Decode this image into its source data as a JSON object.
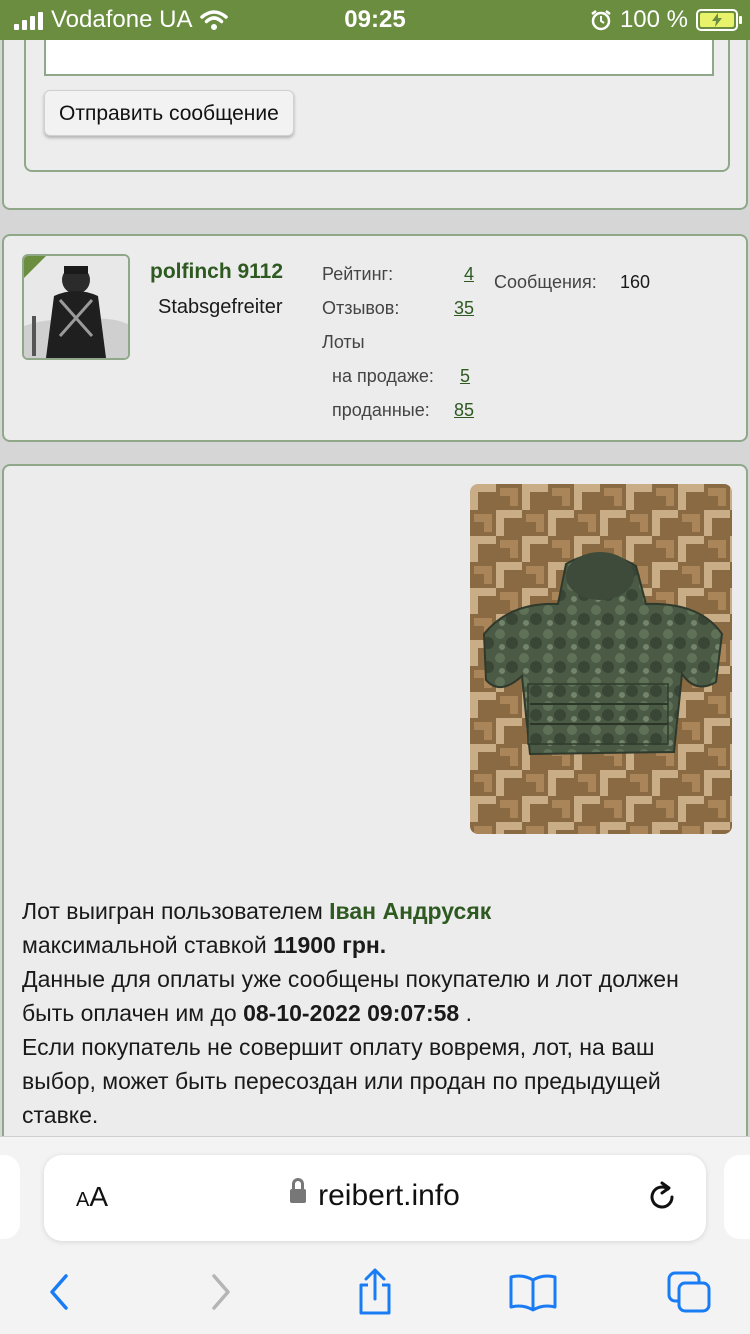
{
  "status_bar": {
    "carrier": "Vodafone UA",
    "time": "09:25",
    "battery": "100 %"
  },
  "reply_form": {
    "send_button": "Отправить сообщение"
  },
  "seller": {
    "username": "polfinch 9112",
    "rank": "Stabsgefreiter",
    "rating_label": "Рейтинг:",
    "rating_value": "4",
    "reviews_label": "Отзывов:",
    "reviews_value": "35",
    "lots_label": "Лоты",
    "on_sale_label": "на продаже:",
    "on_sale_value": "5",
    "sold_label": "проданные:",
    "sold_value": "85",
    "messages_label": "Сообщения:",
    "messages_value": "160"
  },
  "lot": {
    "won_prefix": "Лот выигран пользователем",
    "winner": "Іван Андрусяк",
    "max_bid_prefix": "максимальной ставкой",
    "max_bid": "11900 грн.",
    "payment_text": "Данные для оплаты уже сообщены покупателю и лот должен быть оплачен им до",
    "deadline": "08-10-2022 09:07:58",
    "deadline_suffix": ".",
    "resale_text": "Если покупатель не совершит оплату вовремя, лот, на ваш выбор, может быть пересоздан или продан по предыдущей ставке."
  },
  "safari": {
    "text_size_big": "A",
    "text_size_small": "A",
    "url": "reibert.info"
  },
  "colors": {
    "status_bar": "#6a8d3f",
    "accent_green": "#2e5a22",
    "panel_border": "#8fa88a",
    "ios_blue": "#1a7cf5"
  }
}
